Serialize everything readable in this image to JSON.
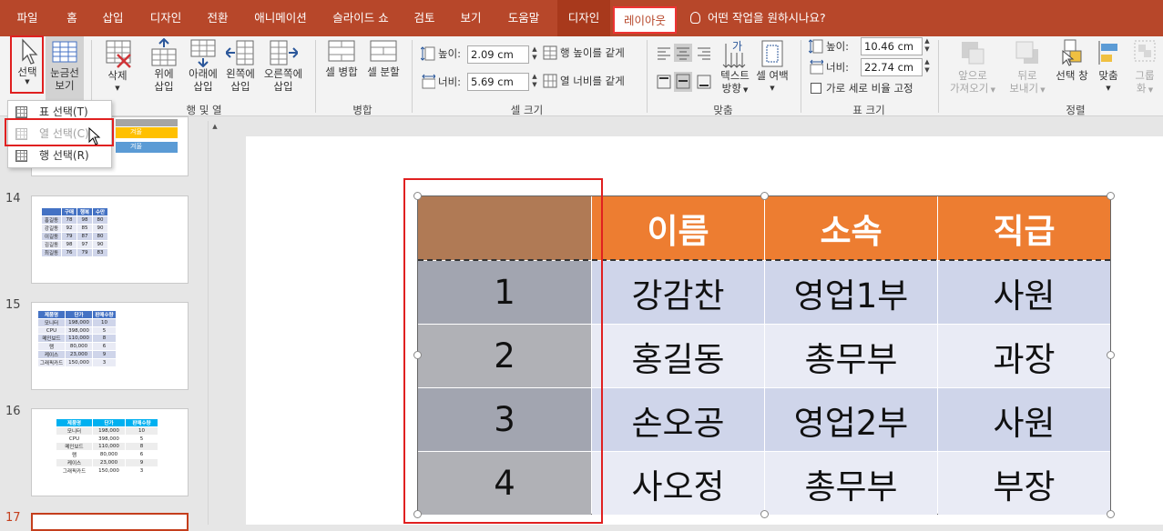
{
  "tabs": [
    "파일",
    "홈",
    "삽입",
    "디자인",
    "전환",
    "애니메이션",
    "슬라이드 쇼",
    "검토",
    "보기",
    "도움말",
    "디자인",
    "레이아웃"
  ],
  "tell_me": "어떤 작업을 원하시나요?",
  "ribbon": {
    "select": "선택",
    "gridlines": [
      "눈금선",
      "보기"
    ],
    "delete": "삭제",
    "insert_above": [
      "위에",
      "삽입"
    ],
    "insert_below": [
      "아래에",
      "삽입"
    ],
    "insert_left": [
      "왼쪽에",
      "삽입"
    ],
    "insert_right": [
      "오른쪽에",
      "삽입"
    ],
    "merge_cells": "셀 병합",
    "split_cells": "셀 분할",
    "height_label": "높이:",
    "height_value": "2.09 cm",
    "width_label": "너비:",
    "width_value": "5.69 cm",
    "distribute_rows": "행 높이를 같게",
    "distribute_cols": "열 너비를 같게",
    "text_direction": [
      "텍스트",
      "방향"
    ],
    "cell_margins": [
      "셀 여백"
    ],
    "table_height_label": "높이:",
    "table_height_value": "10.46 cm",
    "table_width_label": "너비:",
    "table_width_value": "22.74 cm",
    "lock_aspect": "가로 세로 비율 고정",
    "bring_forward": [
      "앞으로",
      "가져오기"
    ],
    "send_backward": [
      "뒤로",
      "보내기"
    ],
    "selection_pane": [
      "선택 창"
    ],
    "align": [
      "맞춤"
    ],
    "group": [
      "그룹",
      "화"
    ],
    "groups": {
      "rows_cols": "행 및 열",
      "merge": "병합",
      "cell_size": "셀 크기",
      "alignment": "맞춤",
      "table_size": "표 크기",
      "arrange": "정렬"
    }
  },
  "select_menu": [
    {
      "label": "표 선택(T)",
      "disabled": false
    },
    {
      "label": "열 선택(C)",
      "disabled": true
    },
    {
      "label": "행 선택(R)",
      "disabled": false
    }
  ],
  "slides": [
    {
      "num": "14",
      "header": [
        "구매",
        "행복",
        "수만"
      ],
      "rows": [
        [
          "홍길동",
          "78",
          "98",
          "80"
        ],
        [
          "강길동",
          "92",
          "85",
          "90"
        ],
        [
          "이길동",
          "79",
          "87",
          "80"
        ],
        [
          "김길동",
          "98",
          "97",
          "90"
        ],
        [
          "최길동",
          "76",
          "79",
          "83"
        ]
      ]
    },
    {
      "num": "15",
      "header": [
        "제품명",
        "단가",
        "판매수량"
      ],
      "rows": [
        [
          "모니터",
          "198,000",
          "10"
        ],
        [
          "CPU",
          "398,000",
          "5"
        ],
        [
          "메인보드",
          "110,000",
          "8"
        ],
        [
          "램",
          "80,000",
          "6"
        ],
        [
          "케이스",
          "23,000",
          "9"
        ],
        [
          "그래픽카드",
          "150,000",
          "3"
        ]
      ]
    },
    {
      "num": "16",
      "header": [
        "제품명",
        "단가",
        "판매수량"
      ],
      "rows": [
        [
          "모니터",
          "198,000",
          "10"
        ],
        [
          "CPU",
          "398,000",
          "5"
        ],
        [
          "메인보드",
          "110,000",
          "8"
        ],
        [
          "램",
          "80,000",
          "6"
        ],
        [
          "케이스",
          "23,000",
          "9"
        ],
        [
          "그래픽카드",
          "150,000",
          "3"
        ]
      ]
    },
    {
      "num": "17"
    }
  ],
  "thumb13_labels": [
    "겨울",
    "겨울"
  ],
  "table": {
    "header": [
      "",
      "이름",
      "소속",
      "직급"
    ],
    "rows": [
      [
        "1",
        "강감찬",
        "영업1부",
        "사원"
      ],
      [
        "2",
        "홍길동",
        "총무부",
        "과장"
      ],
      [
        "3",
        "손오공",
        "영업2부",
        "사원"
      ],
      [
        "4",
        "사오정",
        "총무부",
        "부장"
      ]
    ]
  },
  "colors": {
    "accent": "#b7472a",
    "header": "#ed7d31",
    "selected_col": "#a5a5a5",
    "row_a": "#cfd5ea",
    "row_b": "#e9ebf5"
  }
}
